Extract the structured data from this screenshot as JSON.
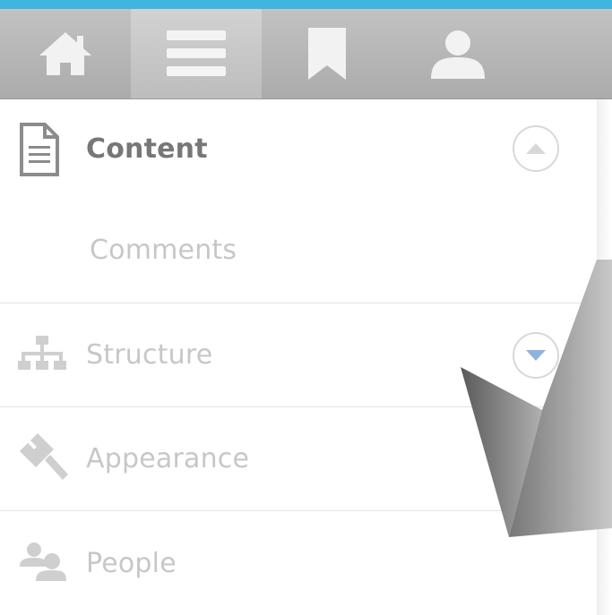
{
  "toolbar": {
    "accent_color": "#3fb6e0",
    "buttons": [
      {
        "icon": "home-icon"
      },
      {
        "icon": "menu-icon",
        "active": true
      },
      {
        "icon": "bookmark-icon"
      },
      {
        "icon": "user-icon"
      }
    ]
  },
  "menu": {
    "content_label": "Content",
    "comments_label": "Comments",
    "structure_label": "Structure",
    "appearance_label": "Appearance",
    "people_label": "People",
    "toggle_collapse_color": "#d8d8d8",
    "toggle_expand_color": "#8fb3dd"
  }
}
